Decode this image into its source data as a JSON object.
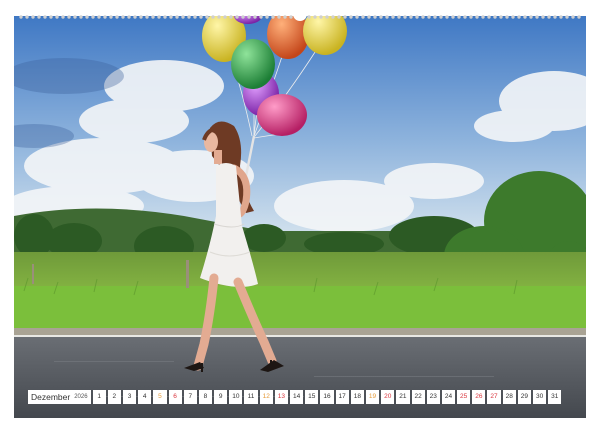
{
  "calendar": {
    "month": "Dezember",
    "year": "2026",
    "days": [
      {
        "d": "1",
        "t": "wd"
      },
      {
        "d": "2",
        "t": "wd"
      },
      {
        "d": "3",
        "t": "wd"
      },
      {
        "d": "4",
        "t": "wd"
      },
      {
        "d": "5",
        "t": "sat"
      },
      {
        "d": "6",
        "t": "sun"
      },
      {
        "d": "7",
        "t": "wd"
      },
      {
        "d": "8",
        "t": "wd"
      },
      {
        "d": "9",
        "t": "wd"
      },
      {
        "d": "10",
        "t": "wd"
      },
      {
        "d": "11",
        "t": "wd"
      },
      {
        "d": "12",
        "t": "sat"
      },
      {
        "d": "13",
        "t": "sun"
      },
      {
        "d": "14",
        "t": "wd"
      },
      {
        "d": "15",
        "t": "wd"
      },
      {
        "d": "16",
        "t": "wd"
      },
      {
        "d": "17",
        "t": "wd"
      },
      {
        "d": "18",
        "t": "wd"
      },
      {
        "d": "19",
        "t": "sat"
      },
      {
        "d": "20",
        "t": "sun"
      },
      {
        "d": "21",
        "t": "wd"
      },
      {
        "d": "22",
        "t": "wd"
      },
      {
        "d": "23",
        "t": "wd"
      },
      {
        "d": "24",
        "t": "wd"
      },
      {
        "d": "25",
        "t": "sun"
      },
      {
        "d": "26",
        "t": "sun"
      },
      {
        "d": "27",
        "t": "sun"
      },
      {
        "d": "28",
        "t": "wd"
      },
      {
        "d": "29",
        "t": "wd"
      },
      {
        "d": "30",
        "t": "wd"
      },
      {
        "d": "31",
        "t": "wd"
      }
    ]
  },
  "colors": {
    "weekday": "#333333",
    "saturday": "#e59a3a",
    "holiday": "#d9363e",
    "sky": "#5a8fd0",
    "road": "#54585e"
  },
  "photo": {
    "subject": "woman-in-white-dress-with-balloons",
    "balloon_colors": [
      "#e8d64a",
      "#e7612b",
      "#e9d13f",
      "#2ea84a",
      "#a23bd1",
      "#e23a8b"
    ]
  }
}
